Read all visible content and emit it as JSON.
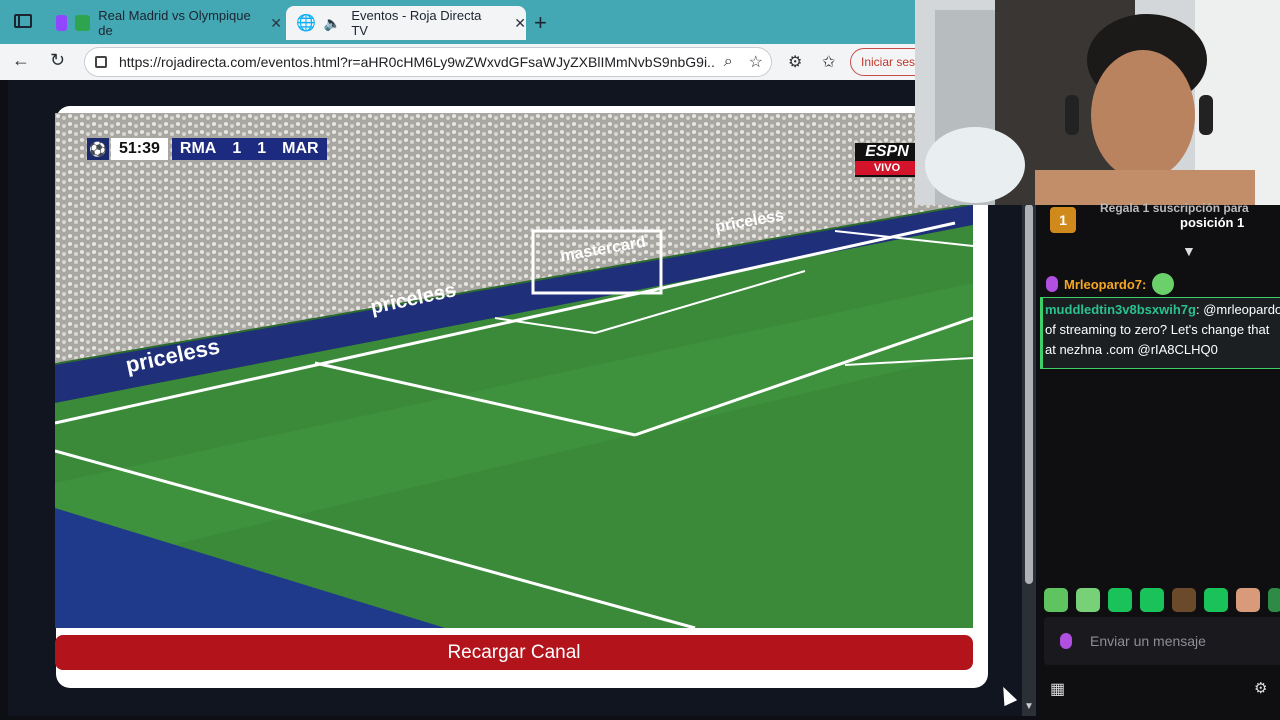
{
  "browser": {
    "tabs": [
      {
        "title": "Real Madrid vs Olympique de",
        "active": false
      },
      {
        "title": "Eventos - Roja Directa TV",
        "active": true
      }
    ],
    "url": "https://rojadirecta.com/eventos.html?r=aHR0cHM6Ly9wZWxvdGFsaWJyZXBlIMmNvbS9nbG9i...",
    "signin_label": "Iniciar sesi"
  },
  "video": {
    "scoreboard": {
      "clock": "51:39",
      "home": "RMA",
      "home_score": "1",
      "away_score": "1",
      "away": "MAR"
    },
    "broadcaster": "ESPN",
    "live_label": "VIVO",
    "ad_text": "priceless",
    "goal_ad": "mastercard"
  },
  "reload_button": "Recargar Canal",
  "chat": {
    "pinned": {
      "rank": "1",
      "line1": "Regala 1 suscripción para",
      "line2": "posición 1"
    },
    "messages": [
      {
        "user": "Mrleopardo7:",
        "text": ""
      },
      {
        "user": "muddledtin3v8bsxwih7g",
        "lines": [
          ": @mrleopardo",
          "of streaming to zero? Let's change that",
          "at nezhna .com @rIA8CLHQ0"
        ]
      }
    ],
    "input_placeholder": "Enviar un mensaje"
  },
  "colors": {
    "tabbar": "#44a8b4",
    "reload": "#b3141c",
    "chat_user_highlight": "#2ac18d",
    "chat_user": "#f5a623"
  }
}
